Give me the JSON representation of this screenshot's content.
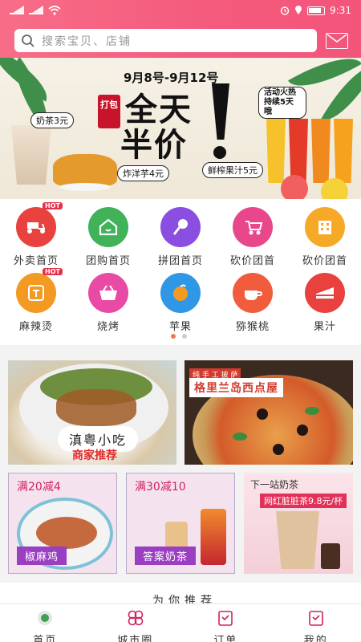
{
  "status_bar": {
    "time": "9:31",
    "battery_icon": "battery-icon",
    "signal_icon": "signal-icon",
    "wifi_icon": "wifi-icon"
  },
  "search": {
    "placeholder": "搜索宝贝、店铺",
    "icon": "search-icon"
  },
  "header_message_icon": "mail-icon",
  "banner": {
    "date_range": "9月8号-9月12号",
    "headline_line1": "全天",
    "headline_line2": "半价",
    "seal_text": "打包",
    "tag_milk_tea": "奶茶3元",
    "tag_fries": "炸洋芋4元",
    "tag_juice": "鲜榨果汁5元",
    "tag_event": "活动火热 持续5天哦"
  },
  "categories": [
    {
      "label": "外卖首页",
      "icon": "scooter-icon",
      "color": "#e8413e",
      "hot": true
    },
    {
      "label": "团购首页",
      "icon": "home-icon",
      "color": "#3fb25a",
      "hot": false
    },
    {
      "label": "拼团首页",
      "icon": "microphone-icon",
      "color": "#8a4ee0",
      "hot": false
    },
    {
      "label": "砍价团首",
      "icon": "stroller-icon",
      "color": "#e8478c",
      "hot": false
    },
    {
      "label": "砍价团首",
      "icon": "building-icon",
      "color": "#f5a927",
      "hot": false
    },
    {
      "label": "麻辣烫",
      "icon": "group-icon",
      "color": "#f29a22",
      "hot": true
    },
    {
      "label": "烧烤",
      "icon": "basket-icon",
      "color": "#e84aa4",
      "hot": false
    },
    {
      "label": "苹果",
      "icon": "orange-icon",
      "color": "#2f97e6",
      "hot": false
    },
    {
      "label": "猕猴桃",
      "icon": "coffee-icon",
      "color": "#f05c3c",
      "hot": false
    },
    {
      "label": "果汁",
      "icon": "cake-icon",
      "color": "#e8413e",
      "hot": false
    }
  ],
  "pager": {
    "pages": 2,
    "active": 1
  },
  "feature_cards": {
    "card1": {
      "label": "滇粤小吃",
      "sub": "商家推荐"
    },
    "card2": {
      "slogan": "纯 手 工 披 萨",
      "label": "格里兰岛西点屋"
    }
  },
  "promo_cards": [
    {
      "promo": "满20减4",
      "name": "椒麻鸡"
    },
    {
      "promo": "满30减10",
      "name": "答案奶茶"
    },
    {
      "top": "下一站奶茶",
      "price": "网红脏脏茶9.8元/杯"
    }
  ],
  "section_peek_title": "为你推荐",
  "bottom_nav": [
    {
      "label": "首页",
      "icon": "home-logo-icon"
    },
    {
      "label": "城市圈",
      "icon": "city-circle-icon"
    },
    {
      "label": "订单",
      "icon": "order-icon"
    },
    {
      "label": "我的",
      "icon": "profile-icon"
    }
  ]
}
